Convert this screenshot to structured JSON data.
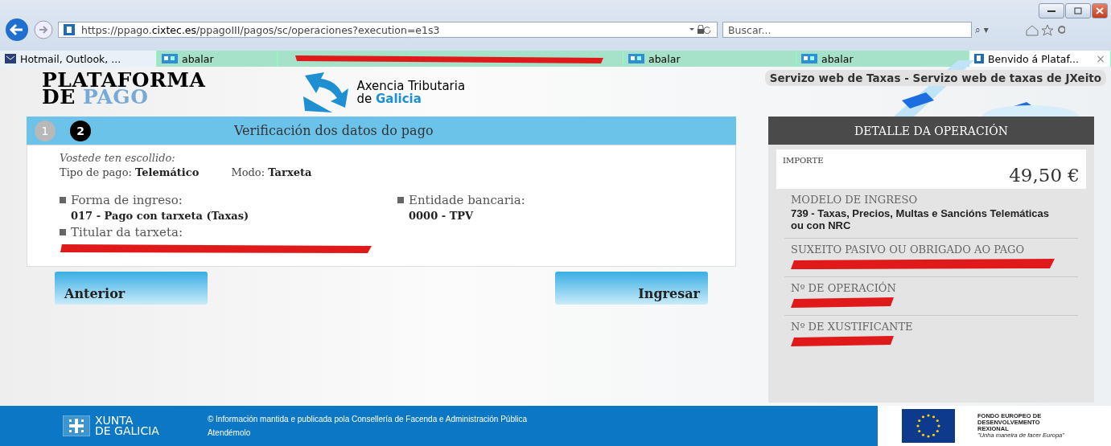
{
  "browser": {
    "address_prefix": "https://ppago.",
    "address_domain": "cixtec.es",
    "address_path": "/ppagoIII/pagos/sc/operaciones?execution=e1s3",
    "search_placeholder": "Buscar...",
    "search_glyph": "⌕ ▾",
    "tabs": [
      {
        "kind": "mail",
        "label": "Hotmail, Outlook, ...",
        "selected": false
      },
      {
        "kind": "site",
        "label": "abalar",
        "selected": false
      },
      {
        "kind": "redacted",
        "selected": false
      },
      {
        "kind": "site",
        "label": "abalar",
        "selected": false
      },
      {
        "kind": "site",
        "label": "abalar",
        "selected": false
      },
      {
        "kind": "page",
        "label": "Benvido á Plataf...",
        "close": "×",
        "selected": true
      }
    ]
  },
  "header": {
    "logo_line1": "PLATAFORMA",
    "logo_line2_a": "DE ",
    "logo_line2_b": "PAGO",
    "agency_line1": "Axencia Tributaria",
    "agency_line2_a": "de ",
    "agency_line2_b": "Galicia",
    "service": "Servizo web de Taxas - Servizo web de taxas de JXeito"
  },
  "steps": [
    {
      "number": "1",
      "selected": false
    },
    {
      "number": "2",
      "selected": true
    }
  ],
  "step_title": "Verificación dos datos do pago",
  "summary": {
    "intro": "Vostede ten escollido:",
    "payment_type_label": "Tipo de pago:",
    "payment_type": "Telemático",
    "mode_label": "Modo:",
    "mode": "Tarxeta"
  },
  "fields": [
    {
      "label": "Forma de ingreso:",
      "value": "017 - Pago con tarxeta (Taxas)",
      "redacted": false
    },
    {
      "label": "Entidade bancaria:",
      "value": "0000 - TPV",
      "redacted": false
    },
    {
      "label": "Titular da tarxeta:",
      "redacted": true
    }
  ],
  "buttons": {
    "back": "Anterior",
    "submit": "Ingresar"
  },
  "detail": {
    "title": "DETALLE DA OPERACIÓN",
    "amount_label": "IMPORTE",
    "amount": "49,50 €",
    "items": [
      {
        "label": "MODELO DE INGRESO",
        "value": "739 - Taxas, Precios, Multas e Sancións Telemáticas ou con NRC",
        "redacted": false
      },
      {
        "label": "SUXEITO PASIVO OU OBRIGADO AO PAGO",
        "redacted": true
      },
      {
        "label": "Nº DE OPERACIÓN",
        "redacted": true
      },
      {
        "label": "Nº DE XUSTIFICANTE",
        "redacted": true
      }
    ]
  },
  "footer": {
    "xunta_line1": "XUNTA",
    "xunta_line2": "DE GALICIA",
    "info": "© Información mantida e publicada pola Consellería de Facenda e Administración Pública",
    "contact": "Atendémolo",
    "eu_line1": "FONDO EUROPEO DE",
    "eu_line2": "DESENVOLVEMENTO",
    "eu_line3": "REXIONAL",
    "eu_motto": "\"Unha maneira de facer Europa\""
  }
}
